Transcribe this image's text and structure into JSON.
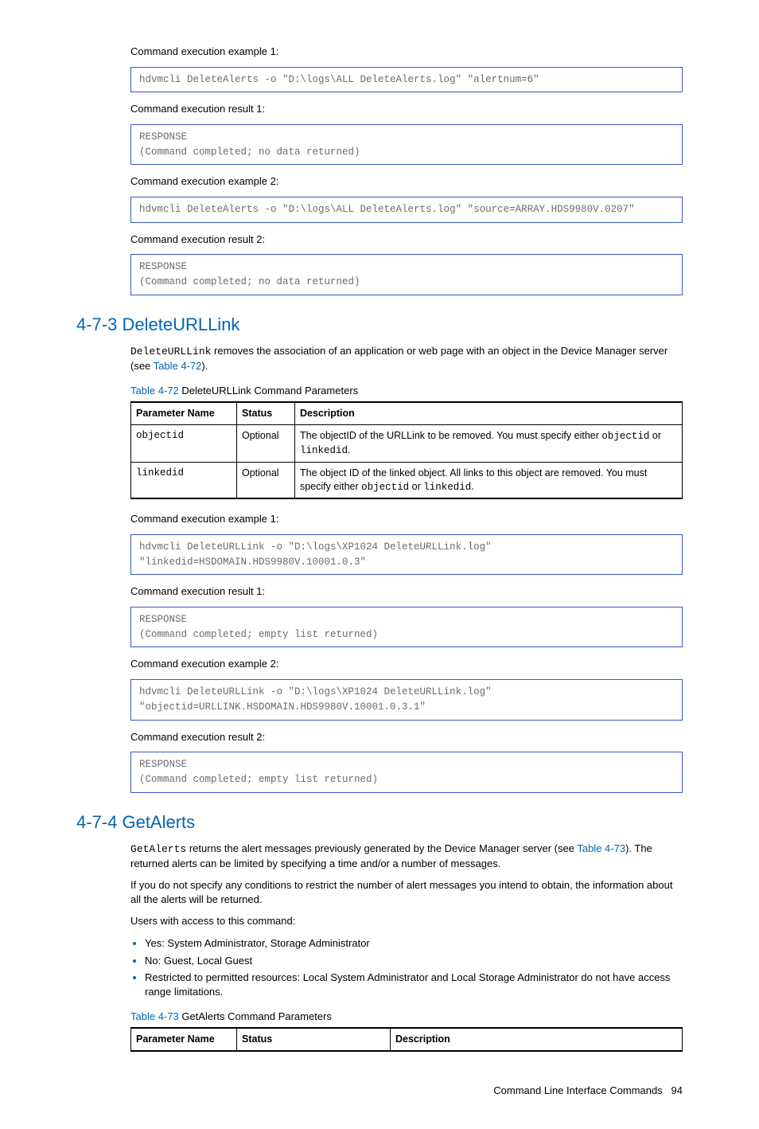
{
  "s1": {
    "exec1_label": "Command execution example 1:",
    "exec1_code": "hdvmcli DeleteAlerts -o \"D:\\logs\\ALL DeleteAlerts.log\" \"alertnum=6\"",
    "res1_label": "Command execution result 1:",
    "res1_code": "RESPONSE\n(Command completed; no data returned)",
    "exec2_label": "Command execution example 2:",
    "exec2_code": "hdvmcli DeleteAlerts -o \"D:\\logs\\ALL DeleteAlerts.log\" \"source=ARRAY.HDS9980V.0207\"",
    "res2_label": "Command execution result 2:",
    "res2_code": "RESPONSE\n(Command completed; no data returned)"
  },
  "s2": {
    "heading": "4-7-3 DeleteURLLink",
    "intro_mono": "DeleteURLLink",
    "intro_rest": " removes the association of an application or web page with an object in the Device Manager server (see ",
    "intro_link": "Table 4-72",
    "intro_close": ").",
    "table_caption_link": "Table 4-72",
    "table_caption_rest": "  DeleteURLLink Command Parameters",
    "th": {
      "c1": "Parameter Name",
      "c2": "Status",
      "c3": "Description"
    },
    "rows": [
      {
        "name": "objectid",
        "status": "Optional",
        "desc_a": "The objectID of the URLLink to be removed. You must specify either ",
        "desc_m1": "objectid",
        "desc_b": " or ",
        "desc_m2": "linkedid",
        "desc_c": "."
      },
      {
        "name": "linkedid",
        "status": "Optional",
        "desc_a": "The object ID of the linked object. All links to this object are removed. You must specify either ",
        "desc_m1": "objectid",
        "desc_b": " or ",
        "desc_m2": "linkedid",
        "desc_c": "."
      }
    ],
    "exec1_label": "Command execution example 1:",
    "exec1_code": "hdvmcli DeleteURLLink -o \"D:\\logs\\XP1024 DeleteURLLink.log\"\n\"linkedid=HSDOMAIN.HDS9980V.10001.0.3\"",
    "res1_label": "Command execution result 1:",
    "res1_code": "RESPONSE\n(Command completed; empty list returned)",
    "exec2_label": "Command execution example 2:",
    "exec2_code": "hdvmcli DeleteURLLink -o \"D:\\logs\\XP1024 DeleteURLLink.log\"\n\"objectid=URLLINK.HSDOMAIN.HDS9980V.10001.0.3.1\"",
    "res2_label": "Command execution result 2:",
    "res2_code": "RESPONSE\n(Command completed; empty list returned)"
  },
  "s3": {
    "heading": "4-7-4 GetAlerts",
    "p1_mono": "GetAlerts",
    "p1_a": " returns the alert messages previously generated by the Device Manager server (see ",
    "p1_link": "Table 4-73",
    "p1_b": "). The returned alerts can be limited by specifying a time and/or a number of messages.",
    "p2": "If you do not specify any conditions to restrict the number of alert messages you intend to obtain, the information about all the alerts will be returned.",
    "p3": "Users with access to this command:",
    "bullets": [
      "Yes: System Administrator, Storage Administrator",
      "No: Guest, Local Guest",
      "Restricted to permitted resources: Local System Administrator and Local Storage Administrator do not have access range limitations."
    ],
    "table_caption_link": "Table 4-73",
    "table_caption_rest": "  GetAlerts Command Parameters",
    "th": {
      "c1": "Parameter Name",
      "c2": "Status",
      "c3": "Description"
    }
  },
  "footer": {
    "text": "Command Line Interface Commands",
    "page": "94"
  }
}
